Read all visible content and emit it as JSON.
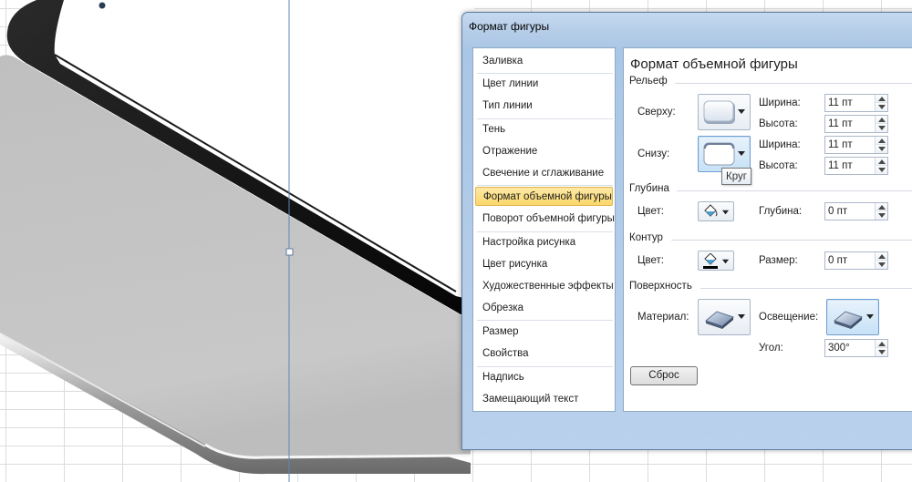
{
  "dialog": {
    "title": "Формат фигуры",
    "panel_title": "Формат объемной фигуры"
  },
  "nav": {
    "items": [
      {
        "label": "Заливка"
      },
      {
        "label": "Цвет линии"
      },
      {
        "label": "Тип линии"
      },
      {
        "label": "Тень"
      },
      {
        "label": "Отражение"
      },
      {
        "label": "Свечение и сглаживание"
      },
      {
        "label": "Формат объемной фигуры"
      },
      {
        "label": "Поворот объемной фигуры"
      },
      {
        "label": "Настройка рисунка"
      },
      {
        "label": "Цвет рисунка"
      },
      {
        "label": "Художественные эффекты"
      },
      {
        "label": "Обрезка"
      },
      {
        "label": "Размер"
      },
      {
        "label": "Свойства"
      },
      {
        "label": "Надпись"
      },
      {
        "label": "Замещающий текст"
      }
    ],
    "selected": "Формат объемной фигуры"
  },
  "bevel": {
    "section": "Рельеф",
    "top_label": "Сверху:",
    "bottom_label": "Снизу:",
    "top_width_label": "Ширина:",
    "top_width": "11 пт",
    "top_height_label": "Высота:",
    "top_height": "11 пт",
    "bottom_width_label": "Ширина:",
    "bottom_width": "11 пт",
    "bottom_height_label": "Высота:",
    "bottom_height": "11 пт",
    "tooltip": "Круг"
  },
  "depth": {
    "section": "Глубина",
    "color_label": "Цвет:",
    "depth_label": "Глубина:",
    "depth_value": "0 пт"
  },
  "contour": {
    "section": "Контур",
    "color_label": "Цвет:",
    "size_label": "Размер:",
    "size_value": "0 пт"
  },
  "surface": {
    "section": "Поверхность",
    "material_label": "Материал:",
    "lighting_label": "Освещение:",
    "angle_label": "Угол:",
    "angle_value": "300°"
  },
  "buttons": {
    "reset": "Сброс"
  },
  "icons": {
    "top_bevel": "bevel-circle-icon",
    "bottom_bevel": "bevel-circle-icon",
    "depth_color": "paint-bucket-icon",
    "contour_color": "paint-bucket-icon",
    "material": "material-icon",
    "lighting": "lighting-icon",
    "dropdown": "chevron-down-icon"
  },
  "colors": {
    "selection": "#fbd86b",
    "dialog_frame": "#b6cde8",
    "tablet_body": "#c4c4c4",
    "tablet_bezel": "#111111"
  }
}
